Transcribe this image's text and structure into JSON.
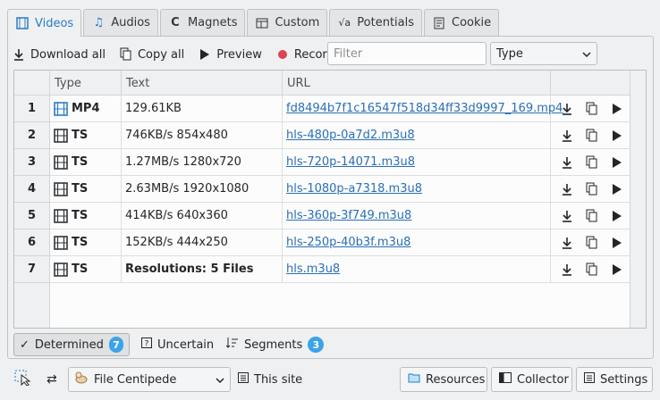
{
  "tabs": [
    {
      "label": "Videos",
      "icon": "video-icon",
      "active": true
    },
    {
      "label": "Audios",
      "icon": "music-note-icon"
    },
    {
      "label": "Magnets",
      "icon": "magnet-icon"
    },
    {
      "label": "Custom",
      "icon": "custom-icon"
    },
    {
      "label": "Potentials",
      "icon": "sqrt-icon"
    },
    {
      "label": "Cookie",
      "icon": "document-icon"
    }
  ],
  "toolbar": {
    "download_all": "Download all",
    "copy_all": "Copy all",
    "preview": "Preview",
    "record": "Record",
    "filter_placeholder": "Filter",
    "type_select": "Type",
    "record_color": "#da4453"
  },
  "table": {
    "headers": [
      "Type",
      "Text",
      "URL"
    ],
    "rows": [
      {
        "num": "1",
        "type": "MP4",
        "text": "129.61KB",
        "url": "fd8494b7f1c16547f518d34ff33d9997_169.mp4",
        "bold_text": false,
        "icon_color": "#2a7cc6"
      },
      {
        "num": "2",
        "type": "TS",
        "text": "746KB/s 854x480",
        "url": "hls-480p-0a7d2.m3u8",
        "bold_text": false,
        "icon_color": "#31363b"
      },
      {
        "num": "3",
        "type": "TS",
        "text": "1.27MB/s 1280x720",
        "url": "hls-720p-14071.m3u8",
        "bold_text": false,
        "icon_color": "#31363b"
      },
      {
        "num": "4",
        "type": "TS",
        "text": "2.63MB/s 1920x1080",
        "url": "hls-1080p-a7318.m3u8",
        "bold_text": false,
        "icon_color": "#31363b"
      },
      {
        "num": "5",
        "type": "TS",
        "text": "414KB/s 640x360",
        "url": "hls-360p-3f749.m3u8",
        "bold_text": false,
        "icon_color": "#31363b"
      },
      {
        "num": "6",
        "type": "TS",
        "text": "152KB/s 444x250",
        "url": "hls-250p-40b3f.m3u8",
        "bold_text": false,
        "icon_color": "#31363b"
      },
      {
        "num": "7",
        "type": "TS",
        "text": "Resolutions: 5 Files",
        "url": "hls.m3u8",
        "bold_text": true,
        "icon_color": "#31363b"
      }
    ]
  },
  "status": {
    "determined": "Determined",
    "determined_count": "7",
    "uncertain": "Uncertain",
    "segments": "Segments",
    "segments_count": "3"
  },
  "footer": {
    "profile": "File Centipede",
    "this_site": "This site",
    "resources": "Resources",
    "collector": "Collector",
    "settings": "Settings"
  }
}
